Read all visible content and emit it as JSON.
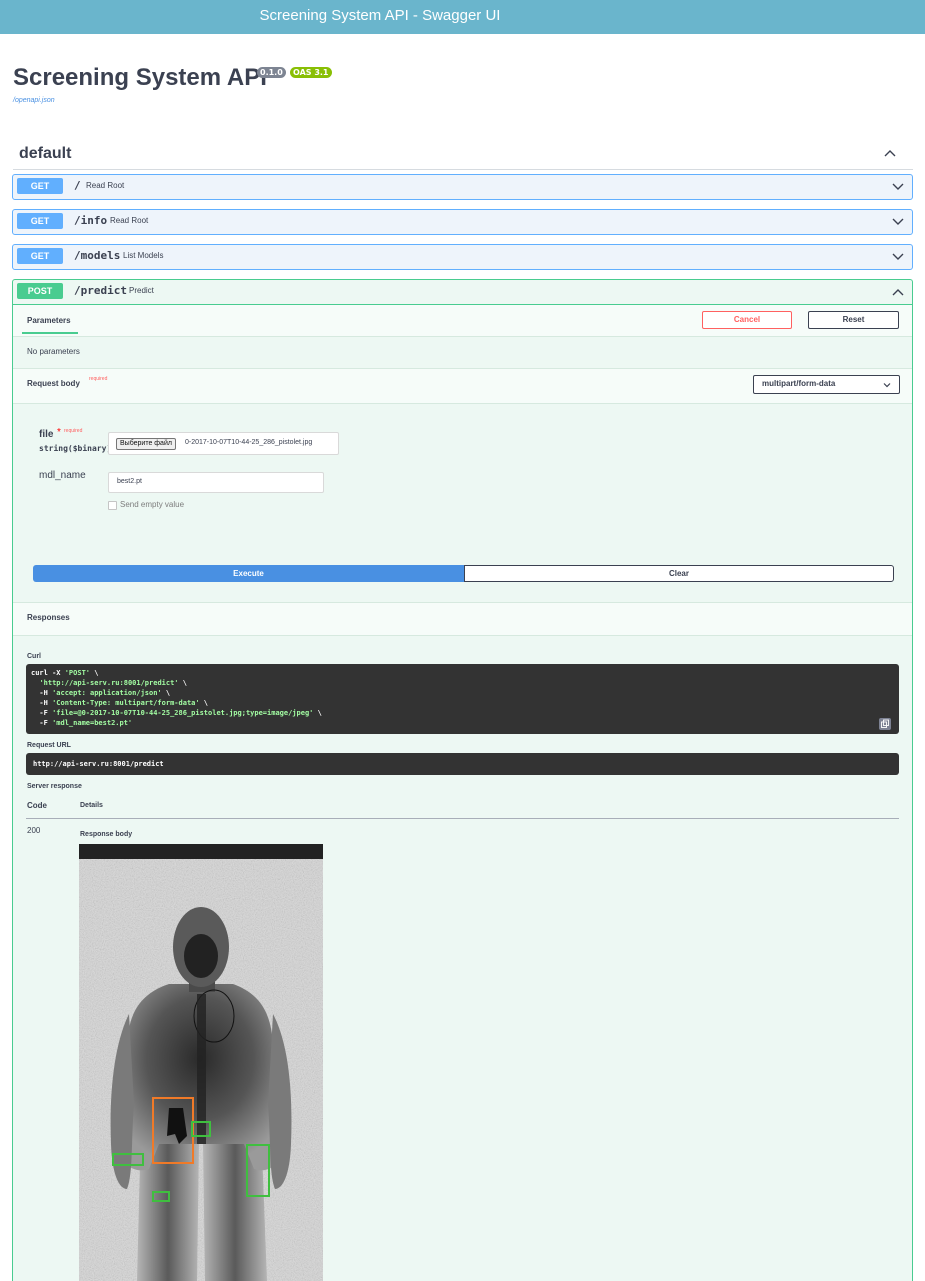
{
  "window_title": "Screening System API - Swagger UI",
  "api": {
    "title": "Screening System API",
    "version_badge": "0.1.0",
    "oas_badge": "OAS 3.1",
    "spec_link": "/openapi.json"
  },
  "section": {
    "title": "default"
  },
  "operations": [
    {
      "method": "GET",
      "path": "/",
      "summary": "Read Root"
    },
    {
      "method": "GET",
      "path": "/info",
      "summary": "Read Root"
    },
    {
      "method": "GET",
      "path": "/models",
      "summary": "List Models"
    },
    {
      "method": "POST",
      "path": "/predict",
      "summary": "Predict"
    }
  ],
  "predict": {
    "parameters_tab": "Parameters",
    "cancel_label": "Cancel",
    "reset_label": "Reset",
    "no_parameters": "No parameters",
    "request_body_label": "Request body",
    "required_label": "required",
    "content_type": "multipart/form-data",
    "file_field": {
      "name": "file",
      "star": "*",
      "required": "required",
      "type": "string($binary)",
      "choose_button": "Выберите файл",
      "file_name": "0-2017-10-07T10-44-25_286_pistolet.jpg"
    },
    "mdl_field": {
      "name": "mdl_name",
      "value": "best2.pt",
      "send_empty_label": "Send empty value"
    },
    "execute_label": "Execute",
    "clear_label": "Clear",
    "responses_label": "Responses",
    "curl_label": "Curl",
    "curl_lines": [
      {
        "plain": "curl -X ",
        "str": "'POST'",
        "tail": " \\"
      },
      {
        "plain": "  ",
        "str": "'http://api-serv.ru:8001/predict'",
        "tail": " \\"
      },
      {
        "plain": "  -H ",
        "str": "'accept: application/json'",
        "tail": " \\"
      },
      {
        "plain": "  -H ",
        "str": "'Content-Type: multipart/form-data'",
        "tail": " \\"
      },
      {
        "plain": "  -F ",
        "str": "'file=@0-2017-10-07T10-44-25_286_pistolet.jpg;type=image/jpeg'",
        "tail": " \\"
      },
      {
        "plain": "  -F ",
        "str": "'mdl_name=best2.pt'",
        "tail": ""
      }
    ],
    "request_url_label": "Request URL",
    "request_url": "http://api-serv.ru:8001/predict",
    "server_response_label": "Server response",
    "code_header": "Code",
    "details_header": "Details",
    "status_code": "200",
    "response_body_label": "Response body"
  },
  "colors": {
    "get": "#61affe",
    "post": "#49cc90",
    "execute": "#4990e2",
    "detection_primary": "#f07a28",
    "detection_secondary": "#3fbf3f"
  },
  "icons": [
    "chevron-up-icon",
    "chevron-down-icon",
    "copy-icon",
    "select-chevron-icon"
  ]
}
